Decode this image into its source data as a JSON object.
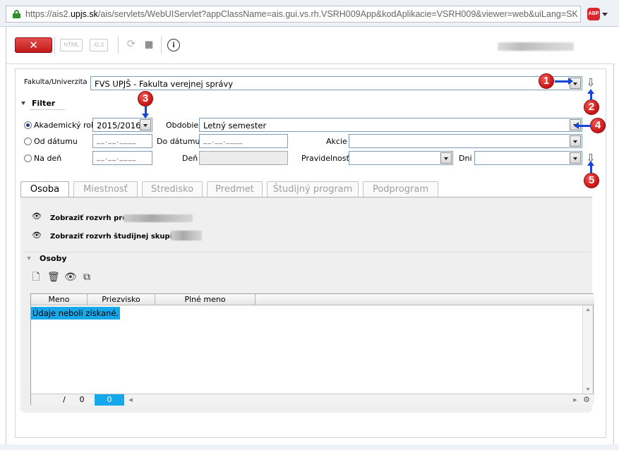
{
  "browser": {
    "url_prefix": "https://ais2.",
    "url_domain": "upjs.sk",
    "url_rest": "/ais/servlets/WebUIServlet?appClassName=ais.gui.vs.rh.VSRH009App&kodAplikacie=VSRH009&viewer=web&uiLang=SK",
    "adblock_label": "ABP"
  },
  "toolbar": {
    "close_label": "✕",
    "html_label": "HTML",
    "xls_label": "XLS",
    "info_label": "i"
  },
  "faculty": {
    "label": "Fakulta/Univerzita",
    "value": "FVS UPJŠ - Fakulta verejnej správy"
  },
  "filter": {
    "title": "Filter",
    "academic_year_label": "Akademický rok",
    "academic_year_value": "2015/2016",
    "period_label": "Obdobie",
    "period_value": "Letný semester",
    "from_date_label": "Od dátumu",
    "from_date_value": "__.__.____",
    "to_date_label": "Do dátumu",
    "to_date_value": "__.__.____",
    "action_label": "Akcie",
    "on_day_label": "Na deň",
    "on_day_value": "__.__.____",
    "day_label": "Deň",
    "regularity_label": "Pravidelnosť",
    "days_label": "Dni"
  },
  "tabs": [
    {
      "label": "Osoba"
    },
    {
      "label": "Miestnosť"
    },
    {
      "label": "Stredisko"
    },
    {
      "label": "Predmet"
    },
    {
      "label": "Študijný program"
    },
    {
      "label": "Podprogram"
    }
  ],
  "osoba_tab": {
    "show_schedule_for": "Zobraziť rozvrh pre",
    "show_group_schedule": "Zobraziť rozvrh študijnej skupiny",
    "section_title": "Osoby",
    "columns": [
      "Meno",
      "Priezvisko",
      "Plné meno"
    ],
    "empty_message": "Údaje neboli získané.",
    "footer_slash": "/",
    "footer_total": "0",
    "footer_selected": "0"
  },
  "annotations": [
    "1",
    "2",
    "3",
    "4",
    "5"
  ],
  "colors": {
    "annotation_red": "#c81414",
    "annotation_arrow": "#1546d4",
    "selection_blue": "#16a8ea",
    "close_button": "#c21a1a"
  }
}
